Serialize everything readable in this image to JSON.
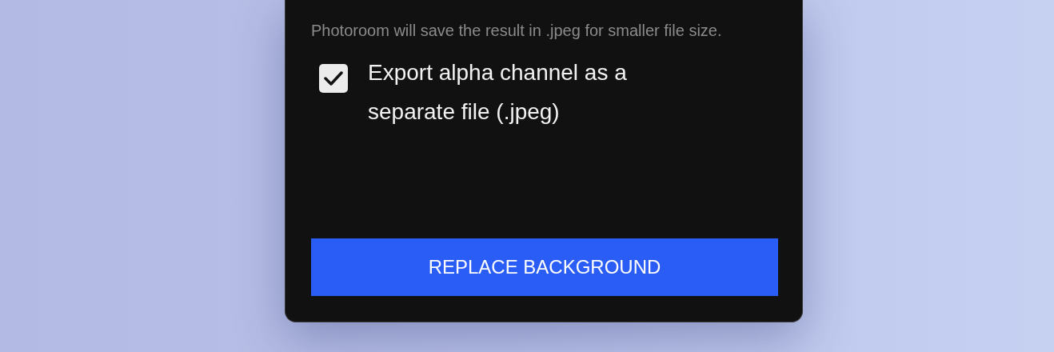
{
  "dialog": {
    "note": "Photoroom will save the result in .jpeg for smaller file size.",
    "option": {
      "label": "Export alpha channel as a separate file (.jpeg)",
      "checked": true
    },
    "button": "REPLACE BACKGROUND"
  }
}
